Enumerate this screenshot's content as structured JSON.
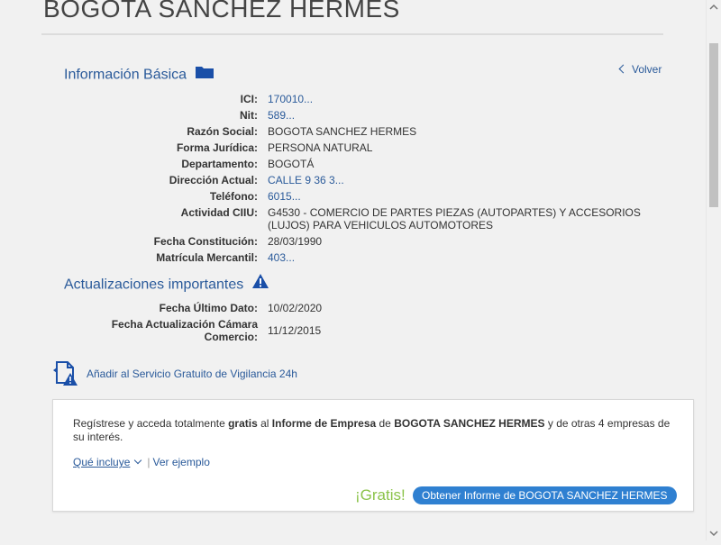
{
  "company_title": "BOGOTA SANCHEZ HERMES",
  "basic": {
    "heading": "Información Básica",
    "back_label": "Volver",
    "fields": [
      {
        "label": "ICI:",
        "value": "170010..."
      },
      {
        "label": "Nit:",
        "value": "589..."
      },
      {
        "label": "Razón Social:",
        "value": "BOGOTA SANCHEZ HERMES"
      },
      {
        "label": "Forma Jurídica:",
        "value": "PERSONA NATURAL"
      },
      {
        "label": "Departamento:",
        "value": "BOGOTÁ"
      },
      {
        "label": "Dirección Actual:",
        "value": "CALLE 9 36 3..."
      },
      {
        "label": "Teléfono:",
        "value": "6015..."
      },
      {
        "label": "Actividad CIIU:",
        "value": "G4530 - COMERCIO DE PARTES PIEZAS (AUTOPARTES) Y ACCESORIOS (LUJOS) PARA VEHICULOS AUTOMOTORES"
      },
      {
        "label": "Fecha Constitución:",
        "value": "28/03/1990"
      },
      {
        "label": "Matrícula Mercantil:",
        "value": "403..."
      }
    ]
  },
  "updates": {
    "heading": "Actualizaciones importantes",
    "fields": [
      {
        "label": "Fecha Último Dato:",
        "value": "10/02/2020"
      },
      {
        "label": "Fecha Actualización Cámara",
        "label2": "Comercio:",
        "value": "11/12/2015"
      }
    ]
  },
  "vigilancia": {
    "label": "Añadir al Servicio Gratuito de Vigilancia 24h"
  },
  "promo": {
    "t1": "Regístrese y acceda totalmente ",
    "t2": "gratis",
    "t3": " al ",
    "t4": "Informe de Empresa",
    "t5": " de ",
    "t6": "BOGOTA SANCHEZ HERMES",
    "t7": " y de otras 4 empresas de su interés.",
    "que_incluye": "Qué incluye",
    "separator": "|",
    "ver_ejemplo": "Ver ejemplo",
    "gratis_label": "¡Gratis!",
    "button_label": "Obtener Informe de BOGOTA SANCHEZ HERMES"
  },
  "colors": {
    "link": "#2a5a9a",
    "button": "#2f80d1",
    "gratis": "#8bc34a"
  },
  "icons": {
    "folder": "folder-icon",
    "warning": "warning-icon",
    "vigilance": "document-alert-icon"
  }
}
